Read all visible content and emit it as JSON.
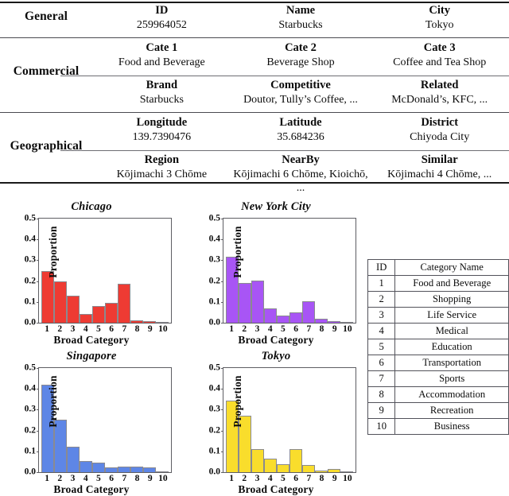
{
  "info_table": {
    "groups": [
      {
        "label": "General",
        "rows": [
          {
            "headers": [
              "ID",
              "Name",
              "City"
            ],
            "values": [
              "259964052",
              "Starbucks",
              "Tokyo"
            ]
          }
        ]
      },
      {
        "label": "Commercial",
        "rows": [
          {
            "headers": [
              "Cate 1",
              "Cate 2",
              "Cate 3"
            ],
            "values": [
              "Food and Beverage",
              "Beverage Shop",
              "Coffee and Tea Shop"
            ]
          },
          {
            "headers": [
              "Brand",
              "Competitive",
              "Related"
            ],
            "values": [
              "Starbucks",
              "Doutor, Tully’s Coffee, ...",
              "McDonald’s, KFC, ..."
            ]
          }
        ]
      },
      {
        "label": "Geographical",
        "rows": [
          {
            "headers": [
              "Longitude",
              "Latitude",
              "District"
            ],
            "values": [
              "139.7390476",
              "35.684236",
              "Chiyoda City"
            ]
          },
          {
            "headers": [
              "Region",
              "NearBy",
              "Similar"
            ],
            "values": [
              "Kōjimachi 3 Chōme",
              "Kōjimachi 6 Chōme, Kioichō, ...",
              "Kōjimachi 4 Chōme, ..."
            ]
          }
        ]
      }
    ]
  },
  "legend_table": {
    "headers": [
      "ID",
      "Category Name"
    ],
    "rows": [
      {
        "id": "1",
        "name": "Food and Beverage"
      },
      {
        "id": "2",
        "name": "Shopping"
      },
      {
        "id": "3",
        "name": "Life Service"
      },
      {
        "id": "4",
        "name": "Medical"
      },
      {
        "id": "5",
        "name": "Education"
      },
      {
        "id": "6",
        "name": "Transportation"
      },
      {
        "id": "7",
        "name": "Sports"
      },
      {
        "id": "8",
        "name": "Accommodation"
      },
      {
        "id": "9",
        "name": "Recreation"
      },
      {
        "id": "10",
        "name": "Business"
      }
    ]
  },
  "chart_data": [
    {
      "type": "bar",
      "title": "Chicago",
      "xlabel": "Broad Category",
      "ylabel": "Proportion",
      "categories": [
        "1",
        "2",
        "3",
        "4",
        "5",
        "6",
        "7",
        "8",
        "9",
        "10"
      ],
      "values": [
        0.248,
        0.198,
        0.128,
        0.042,
        0.079,
        0.094,
        0.186,
        0.012,
        0.009,
        0.002
      ],
      "ylim": [
        0.0,
        0.5
      ],
      "yticks": [
        "0.0",
        "0.1",
        "0.2",
        "0.3",
        "0.4",
        "0.5"
      ],
      "color": "#EE3B33",
      "grid": false,
      "legend": "none"
    },
    {
      "type": "bar",
      "title": "New York City",
      "xlabel": "Broad Category",
      "ylabel": "Proportion",
      "categories": [
        "1",
        "2",
        "3",
        "4",
        "5",
        "6",
        "7",
        "8",
        "9",
        "10"
      ],
      "values": [
        0.318,
        0.19,
        0.204,
        0.07,
        0.033,
        0.049,
        0.104,
        0.021,
        0.009,
        0.002
      ],
      "ylim": [
        0.0,
        0.5
      ],
      "yticks": [
        "0.0",
        "0.1",
        "0.2",
        "0.3",
        "0.4",
        "0.5"
      ],
      "color": "#A855F5",
      "grid": false,
      "legend": "none"
    },
    {
      "type": "bar",
      "title": "Singapore",
      "xlabel": "Broad Category",
      "ylabel": "Proportion",
      "categories": [
        "1",
        "2",
        "3",
        "4",
        "5",
        "6",
        "7",
        "8",
        "9",
        "10"
      ],
      "values": [
        0.42,
        0.253,
        0.122,
        0.054,
        0.047,
        0.024,
        0.025,
        0.025,
        0.022,
        0.001
      ],
      "ylim": [
        0.0,
        0.5
      ],
      "yticks": [
        "0.0",
        "0.1",
        "0.2",
        "0.3",
        "0.4",
        "0.5"
      ],
      "color": "#5E86E6",
      "grid": false,
      "legend": "none"
    },
    {
      "type": "bar",
      "title": "Tokyo",
      "xlabel": "Broad Category",
      "ylabel": "Proportion",
      "categories": [
        "1",
        "2",
        "3",
        "4",
        "5",
        "6",
        "7",
        "8",
        "9",
        "10"
      ],
      "values": [
        0.342,
        0.27,
        0.112,
        0.065,
        0.037,
        0.111,
        0.033,
        0.008,
        0.015,
        0.001
      ],
      "ylim": [
        0.0,
        0.5
      ],
      "yticks": [
        "0.0",
        "0.1",
        "0.2",
        "0.3",
        "0.4",
        "0.5"
      ],
      "color": "#F9DD2C",
      "grid": false,
      "legend": "none"
    }
  ]
}
